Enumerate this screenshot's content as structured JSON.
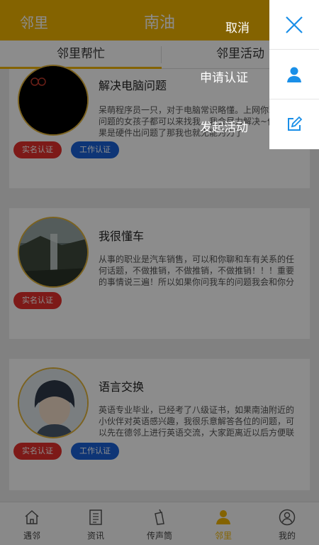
{
  "header": {
    "left_title": "邻里",
    "center_title": "南油"
  },
  "tabs": [
    {
      "label": "邻里帮忙",
      "active": true
    },
    {
      "label": "邻里活动",
      "active": false
    }
  ],
  "cards": [
    {
      "title": "解决电脑问题",
      "description": "呆萌程序员一只，对于电脑常识略懂。上网你现任何问题的女孩子都可以来找我，我会尽力解决~但是如果是硬件出问题了那我也就无能为力了",
      "badges": [
        "实名认证",
        "工作认证"
      ]
    },
    {
      "title": "我很懂车",
      "description": "从事的职业是汽车销售，可以和你聊和车有关系的任何话题，不做推销，不做推销，不做推销！！！重要的事情说三遍！所以如果你问我车的问题我会和你分",
      "badges": [
        "实名认证"
      ]
    },
    {
      "title": "语言交换",
      "description": "英语专业毕业，已经考了八级证书，如果南油附近的小伙伴对英语感兴趣，我很乐意解答各位的问题，可以先在德邻上进行英语交流，大家距离近以后方便联",
      "badges": [
        "实名认证",
        "工作认证"
      ]
    }
  ],
  "bottom_nav": [
    {
      "label": "遇邻",
      "icon": "house-icon"
    },
    {
      "label": "资讯",
      "icon": "document-icon"
    },
    {
      "label": "传声筒",
      "icon": "phone-icon"
    },
    {
      "label": "邻里",
      "icon": "person-icon",
      "active": true
    },
    {
      "label": "我的",
      "icon": "profile-icon"
    }
  ],
  "popup": {
    "cancel_label": "取消",
    "apply_label": "申请认证",
    "activity_label": "发起活动"
  },
  "colors": {
    "brand": "#f0b400",
    "badge_real_name": "#e4302c",
    "badge_work": "#1a62d8",
    "popup_icon": "#1a8fe8"
  }
}
